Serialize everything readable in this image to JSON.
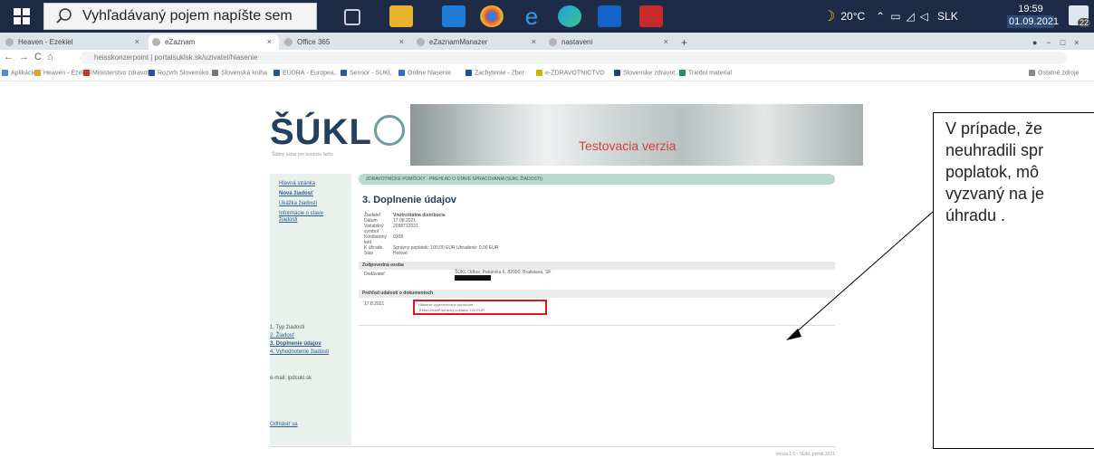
{
  "taskbar": {
    "search_placeholder": "Vyhľadávaný pojem napíšte sem",
    "weather": "20°C",
    "lang": "SLK",
    "time": "19:59",
    "date": "01.09.2021",
    "notif_count": "22"
  },
  "browser": {
    "tabs": [
      {
        "label": "Heaven - Ezekiel"
      },
      {
        "label": "eZaznam"
      },
      {
        "label": "Office 365"
      },
      {
        "label": "eZaznamManazer"
      },
      {
        "label": "nastaveni"
      }
    ],
    "url": "heisskonzerpoint | portalsuklsk.sk/uzivatel/hlasenie",
    "bookmarks": [
      "Aplikácie",
      "Heaven - Ezekiel",
      "Ministerstvo zdravot...",
      "Rozvrh Slovensko...",
      "Slovenská kniha",
      "EUDRA - Europea...",
      "Sensor - SUKL",
      "Online hlasenie",
      "Zachytenie - Zber",
      "e-ZDRAVOTNICTVO",
      "Slovenske zdravot...",
      "Triedni material",
      "Ostatné zdroje"
    ]
  },
  "page": {
    "logo": "ŠÚKL",
    "logo_sub": "Štátny ústav pre kontrolu liečiv",
    "banner_text": "Testovacia verzia",
    "sidebar_links": [
      "Hlavná stránka",
      "Nová žiadosť",
      "Ukážka žiadosti",
      "Informácie o stave žiadosti"
    ],
    "steps": [
      "1. Typ žiadosti",
      "2. Žiadosť",
      "3. Doplnenie údajov",
      "4. Vyhodnotenie žiadosti"
    ],
    "email": "e-mail: ipdsukl.sk",
    "logout": "Odhlásiť sa",
    "breadcrumb": "ZDRAVOTNÍCKE POMÔCKY - PREHĽAD O STAVE SPRACOVANIA (SÚKL ŽIADOSTI)",
    "heading": "3. Doplnenie údajov",
    "info": [
      {
        "k": "Žiadateľ",
        "v": "Vnútroštátna distribúcia"
      },
      {
        "k": "Dátum",
        "v": "17.08.2021"
      },
      {
        "k": "Variabilný symbol",
        "v": "2098712021"
      },
      {
        "k": "Konštantný kód",
        "v": "0308"
      },
      {
        "k": "K úhrade",
        "v": "Správny poplatok: 100,00 EUR  Uhradené: 0,00 EUR"
      },
      {
        "k": "Stav",
        "v": "Hotové"
      }
    ],
    "section_odb": "Zodpovedná osoba",
    "odb_label": "Dodávateľ",
    "odb_value": "ŠÚKL Odbor, Pekárska 6, 82000, Bratislava, SK",
    "section_hist": "Prehľad udalostí o dokumentoch",
    "hist_date": "17.8.2021",
    "hist_line1": "Hlásenie vygenerované správcom",
    "hist_line2": "Treba uhradiť správny poplatok 100 EUR",
    "footer": "verzia 1.0 - SÚKL portál 2021"
  },
  "callout": {
    "text": "V prípade, že\nneuhradili spr\npoplatok, mô\nvyzvaný na je\núhradu ."
  }
}
